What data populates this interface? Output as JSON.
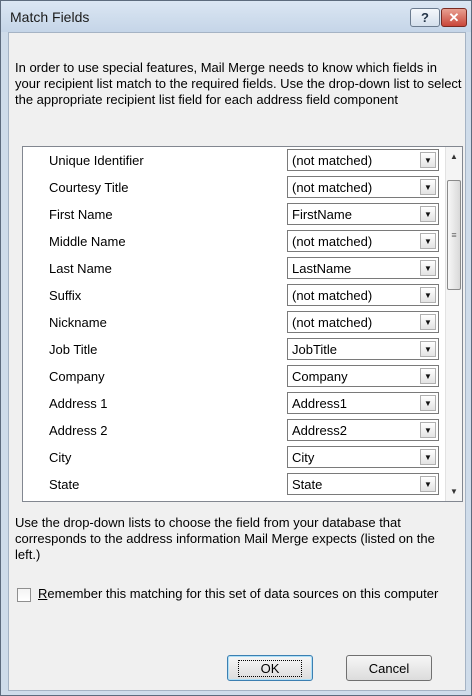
{
  "window": {
    "title": "Match Fields",
    "help_label": "?",
    "close_label": "✕"
  },
  "intro": "In order to use special features, Mail Merge needs to know which fields in your recipient list match to the required fields.  Use the drop-down list to select the appropriate recipient list field for each address field component",
  "fields": [
    {
      "name": "Unique Identifier",
      "value": "(not matched)"
    },
    {
      "name": "Courtesy Title",
      "value": "(not matched)"
    },
    {
      "name": "First Name",
      "value": "FirstName"
    },
    {
      "name": "Middle Name",
      "value": "(not matched)"
    },
    {
      "name": "Last Name",
      "value": "LastName"
    },
    {
      "name": "Suffix",
      "value": "(not matched)"
    },
    {
      "name": "Nickname",
      "value": "(not matched)"
    },
    {
      "name": "Job Title",
      "value": "JobTitle"
    },
    {
      "name": "Company",
      "value": "Company"
    },
    {
      "name": "Address 1",
      "value": "Address1"
    },
    {
      "name": "Address 2",
      "value": "Address2"
    },
    {
      "name": "City",
      "value": "City"
    },
    {
      "name": "State",
      "value": "State"
    }
  ],
  "footer_text": "Use the drop-down lists to choose the field from your database that corresponds to the address information Mail Merge expects (listed on the left.)",
  "remember": {
    "label": "Remember this matching for this set of data sources on this computer",
    "checked": false
  },
  "buttons": {
    "ok": "OK",
    "cancel": "Cancel"
  }
}
